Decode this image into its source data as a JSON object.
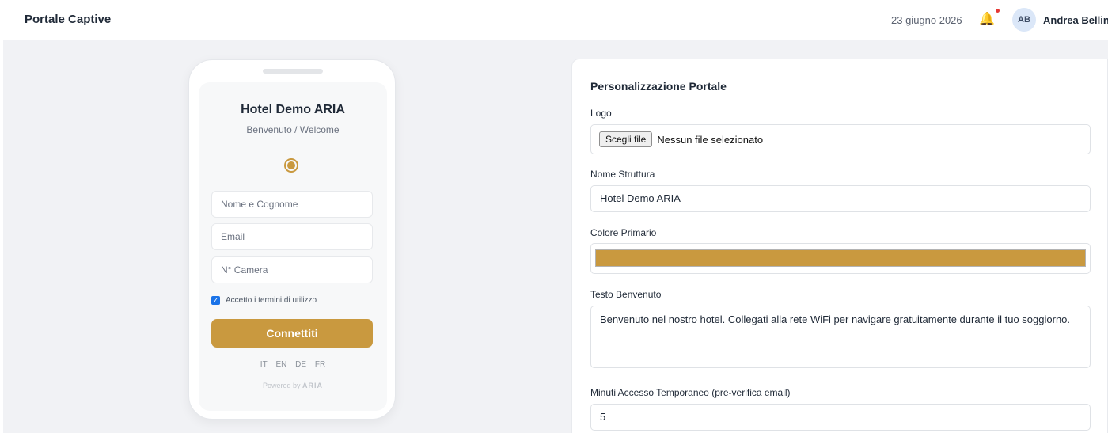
{
  "header": {
    "title": "Portale Captive",
    "date": "23 giugno 2026",
    "user_initials": "AB",
    "user_name": "Andrea Bellini"
  },
  "preview": {
    "hotel_name": "Hotel Demo ARIA",
    "welcome": "Benvenuto / Welcome",
    "name_placeholder": "Nome e Cognome",
    "email_placeholder": "Email",
    "room_placeholder": "N° Camera",
    "terms_label": "Accetto i termini di utilizzo",
    "terms_checked": true,
    "connect_label": "Connettiti",
    "languages": [
      "IT",
      "EN",
      "DE",
      "FR"
    ],
    "powered_prefix": "Powered by",
    "powered_brand": "ARIA",
    "accent_color": "#c9993f"
  },
  "settings": {
    "title": "Personalizzazione Portale",
    "logo_label": "Logo",
    "file_button": "Scegli file",
    "file_status": "Nessun file selezionato",
    "name_label": "Nome Struttura",
    "name_value": "Hotel Demo ARIA",
    "color_label": "Colore Primario",
    "color_value": "#c9993f",
    "welcome_label": "Testo Benvenuto",
    "welcome_value": "Benvenuto nel nostro hotel. Collegati alla rete WiFi per navigare gratuitamente durante il tuo soggiorno.",
    "minutes_label": "Minuti Accesso Temporaneo (pre-verifica email)",
    "minutes_value": "5"
  },
  "icons": {
    "notification": "bell-icon",
    "checkbox": "check-icon"
  },
  "colors": {
    "notification_dot": "#e53935",
    "avatar_bg": "#dbe7f8"
  }
}
